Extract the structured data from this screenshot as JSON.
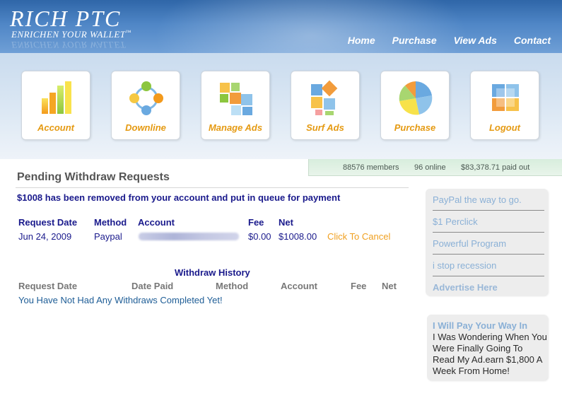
{
  "brand": {
    "title": "RICH PTC",
    "tagline": "ENRICHEN YOUR WALLET",
    "tagline_mark": "™"
  },
  "topnav": [
    {
      "label": "Home"
    },
    {
      "label": "Purchase"
    },
    {
      "label": "View Ads"
    },
    {
      "label": "Contact"
    }
  ],
  "iconbar": [
    {
      "label": "Account",
      "icon": "bar-chart-icon"
    },
    {
      "label": "Downline",
      "icon": "network-icon"
    },
    {
      "label": "Manage Ads",
      "icon": "blocks-icon"
    },
    {
      "label": "Surf Ads",
      "icon": "tiles-icon"
    },
    {
      "label": "Purchase",
      "icon": "pie-chart-icon"
    },
    {
      "label": "Logout",
      "icon": "window-icon"
    }
  ],
  "stats": {
    "members": "88576 members",
    "online": "96 online",
    "paid": "$83,378.71 paid out"
  },
  "pending": {
    "title": "Pending Withdraw Requests",
    "notice": "$1008 has been removed from your account and put in queue for payment",
    "headers": {
      "date": "Request Date",
      "method": "Method",
      "account": "Account",
      "fee": "Fee",
      "net": "Net"
    },
    "row": {
      "date": "Jun 24, 2009",
      "method": "Paypal",
      "fee": "$0.00",
      "net": "$1008.00",
      "action": "Click To Cancel"
    }
  },
  "history": {
    "title": "Withdraw History",
    "headers": {
      "request_date": "Request Date",
      "date_paid": "Date Paid",
      "method": "Method",
      "account": "Account",
      "fee": "Fee",
      "net": "Net"
    },
    "empty": "You Have Not Had Any Withdraws Completed Yet!"
  },
  "sidebar": {
    "links": [
      {
        "label": "PayPal the way to go."
      },
      {
        "label": "$1 Perclick"
      },
      {
        "label": "Powerful Program"
      },
      {
        "label": "i stop recession"
      },
      {
        "label": "Advertise Here"
      }
    ],
    "ad": {
      "title": "I Will Pay Your Way In",
      "text": "I Was Wondering When You Were Finally Going To Read My Ad.earn $1,800 A Week From Home!"
    }
  },
  "colors": {
    "accent_orange": "#e59a12",
    "text_navy": "#1a1a8c",
    "header_blue": "#3f76b8"
  }
}
